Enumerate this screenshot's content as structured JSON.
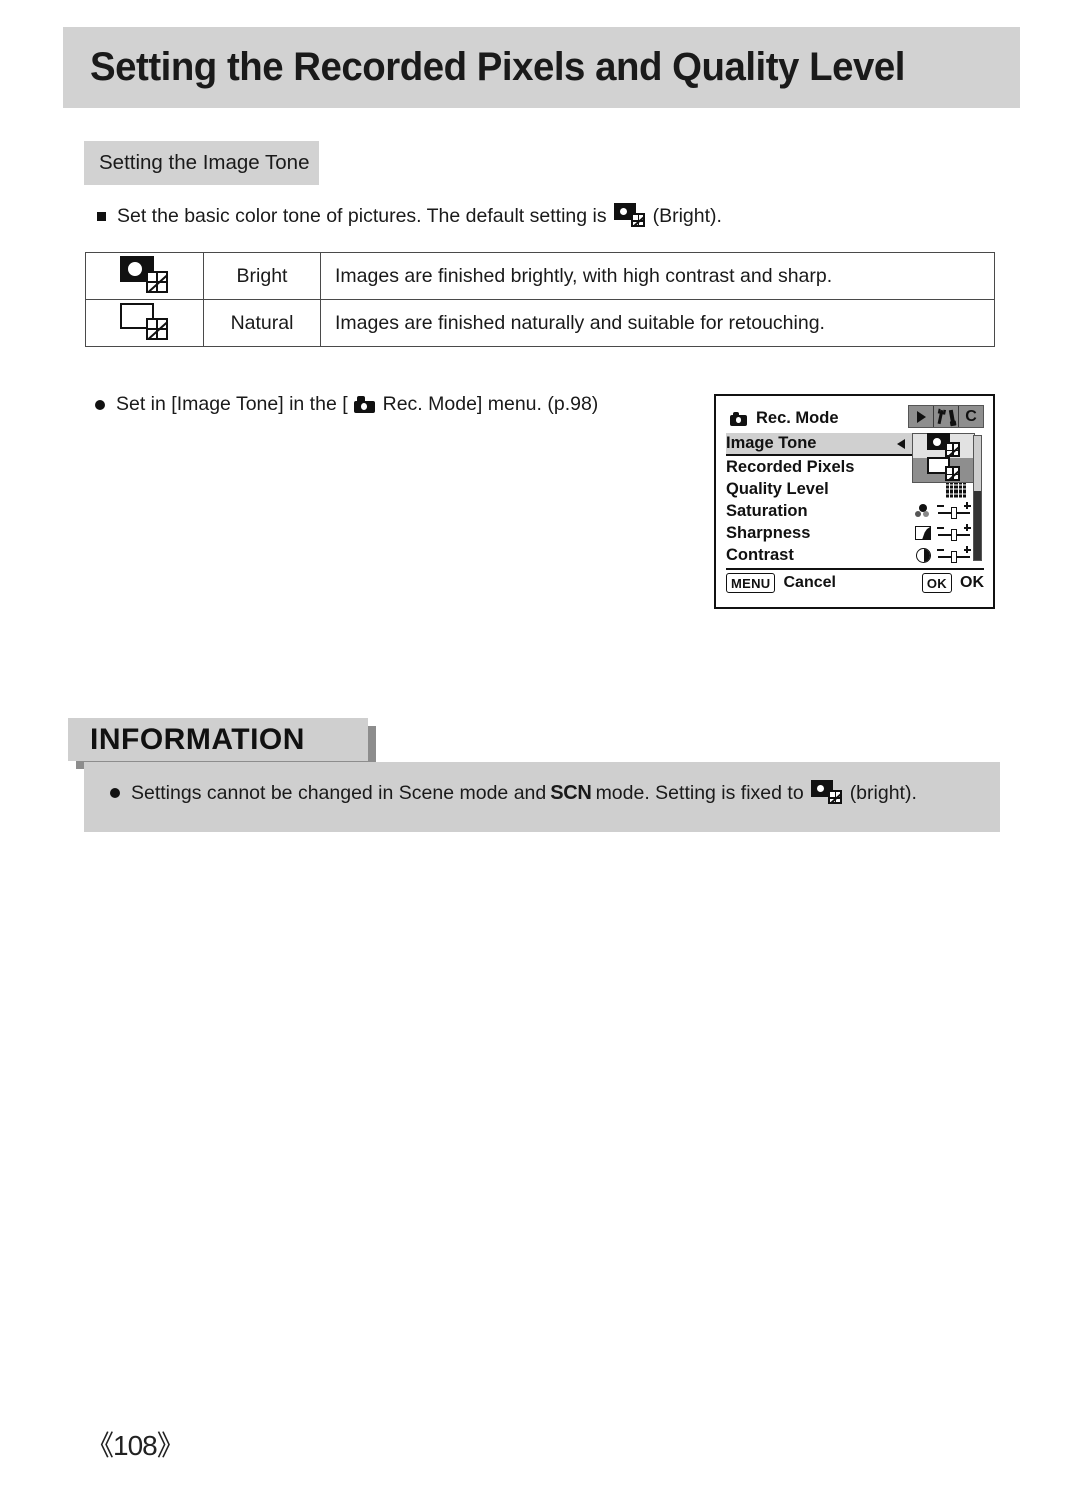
{
  "page": {
    "title": "Setting the Recorded Pixels and Quality Level",
    "number": "《108》"
  },
  "subsection": {
    "heading": "Setting the Image Tone"
  },
  "intro": {
    "text_before": "Set the basic color tone of pictures. The default setting is",
    "icon": "image-tone-bright-icon",
    "text_after": "(Bright)."
  },
  "tone_table": {
    "rows": [
      {
        "icon": "image-tone-bright-icon",
        "name": "Bright",
        "description": "Images are finished brightly, with high contrast and sharp."
      },
      {
        "icon": "image-tone-natural-icon",
        "name": "Natural",
        "description": "Images are finished naturally and suitable for retouching."
      }
    ]
  },
  "set_in_note": {
    "text_before": "Set in [Image Tone] in the [",
    "icon": "camera-icon",
    "text_after": "Rec. Mode] menu. (p.98)"
  },
  "lcd": {
    "header": {
      "icon": "camera-icon",
      "title": "Rec. Mode",
      "tabs": [
        {
          "name": "playback-tab",
          "icon": "play-triangle-icon",
          "label": ""
        },
        {
          "name": "setup-tab",
          "icon": "tools-icon",
          "label": ""
        },
        {
          "name": "custom-tab",
          "icon": "c-letter-icon",
          "label": "C"
        }
      ]
    },
    "menu_items": [
      {
        "label": "Image Tone",
        "icon": "image-tone-bright-icon",
        "selected": true
      },
      {
        "label": "Recorded Pixels",
        "icon": "",
        "selected": false
      },
      {
        "label": "Quality Level",
        "icon": "quality-grid-icon",
        "selected": false
      },
      {
        "label": "Saturation",
        "icon": "saturation-slider-icon",
        "selected": false
      },
      {
        "label": "Sharpness",
        "icon": "sharpness-slider-icon",
        "selected": false
      },
      {
        "label": "Contrast",
        "icon": "contrast-slider-icon",
        "selected": false
      }
    ],
    "popup_options": [
      {
        "icon": "image-tone-bright-icon",
        "selected": true
      },
      {
        "icon": "image-tone-natural-icon",
        "selected": false
      }
    ],
    "footer": {
      "menu_key": "MENU",
      "menu_action": "Cancel",
      "ok_key": "OK",
      "ok_action": "OK"
    }
  },
  "information": {
    "heading": "INFORMATION",
    "note_before": "Settings cannot be changed in Scene mode and",
    "scn_badge": "SCN",
    "note_middle": "mode. Setting is fixed to",
    "icon": "image-tone-bright-icon",
    "note_after": "(bright)."
  },
  "colors": {
    "band_gray": "#d2d2d2",
    "info_gray": "#cfcfcf",
    "shadow_gray": "#8d8d8d",
    "text_black": "#1a1a1a"
  }
}
